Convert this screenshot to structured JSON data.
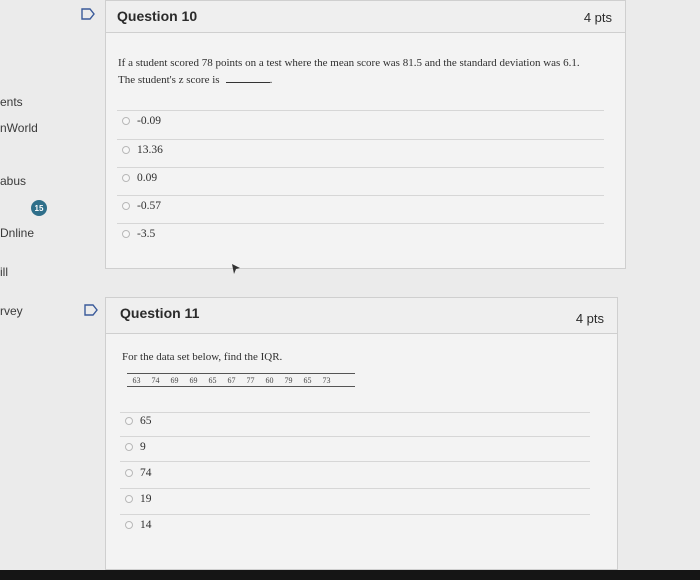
{
  "sidebar": {
    "items": [
      "ents",
      "nWorld",
      "abus",
      "Dnline",
      "ill",
      "rvey"
    ],
    "badge": "15"
  },
  "questions": [
    {
      "title": "Question 10",
      "points": "4 pts",
      "text_line1": "If a student scored 78 points on a test where the mean score was 81.5 and the standard deviation was 6.1.",
      "text_line2": "The student's z score is",
      "text_end": ".",
      "options": [
        "-0.09",
        "13.36",
        "0.09",
        "-0.57",
        "-3.5"
      ]
    },
    {
      "title": "Question 11",
      "points": "4 pts",
      "text": "For the data set below, find the IQR.",
      "data": [
        "63",
        "74",
        "69",
        "69",
        "65",
        "67",
        "77",
        "60",
        "79",
        "65",
        "73"
      ],
      "options": [
        "65",
        "9",
        "74",
        "19",
        "14"
      ]
    }
  ],
  "colors": {
    "badge": "#2f6f8a",
    "background": "#ebebeb",
    "panel": "#f3f3f3"
  }
}
